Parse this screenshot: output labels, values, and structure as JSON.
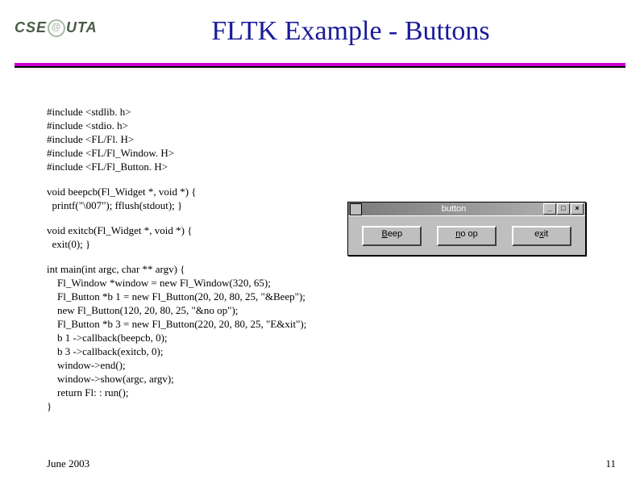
{
  "logo": {
    "left": "CSE",
    "right": "UTA"
  },
  "title": "FLTK Example - Buttons",
  "code": {
    "includes": "#include <stdlib. h>\n#include <stdio. h>\n#include <FL/Fl. H>\n#include <FL/Fl_Window. H>\n#include <FL/Fl_Button. H>",
    "beepcb": "void beepcb(Fl_Widget *, void *) {\n  printf(\"\\007\"); fflush(stdout); }",
    "exitcb": "void exitcb(Fl_Widget *, void *) {\n  exit(0); }",
    "main": "int main(int argc, char ** argv) {\n    Fl_Window *window = new Fl_Window(320, 65);\n    Fl_Button *b 1 = new Fl_Button(20, 20, 80, 25, \"&Beep\");\n    new Fl_Button(120, 20, 80, 25, \"&no op\");\n    Fl_Button *b 3 = new Fl_Button(220, 20, 80, 25, \"E&xit\");\n    b 1 ->callback(beepcb, 0);\n    b 3 ->callback(exitcb, 0);\n    window->end();\n    window->show(argc, argv);\n    return Fl: : run();\n}"
  },
  "fltk_window": {
    "title": "button",
    "buttons": [
      {
        "prefix": "",
        "ul": "B",
        "suffix": "eep"
      },
      {
        "prefix": "",
        "ul": "n",
        "suffix": "o op"
      },
      {
        "prefix": "e",
        "ul": "x",
        "suffix": "it"
      }
    ],
    "controls": {
      "min": "_",
      "max": "□",
      "close": "×"
    }
  },
  "footer": {
    "date": "June 2003",
    "page": "11"
  }
}
